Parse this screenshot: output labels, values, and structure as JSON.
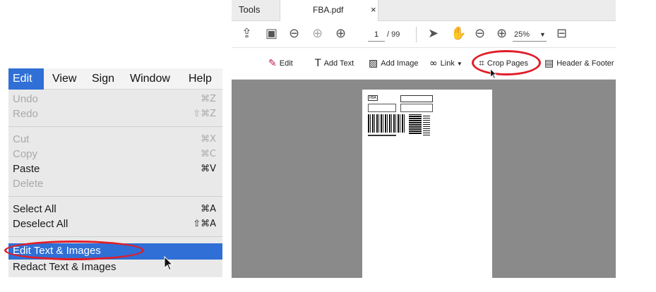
{
  "menubar": {
    "items": [
      "Edit",
      "View",
      "Sign",
      "Window",
      "Help"
    ]
  },
  "edit_menu": {
    "items": [
      {
        "label": "Undo",
        "shortcut": "⌘Z",
        "enabled": false
      },
      {
        "label": "Redo",
        "shortcut": "⇧⌘Z",
        "enabled": false
      },
      {
        "label": "Cut",
        "shortcut": "⌘X",
        "enabled": false
      },
      {
        "label": "Copy",
        "shortcut": "⌘C",
        "enabled": false
      },
      {
        "label": "Paste",
        "shortcut": "⌘V",
        "enabled": true
      },
      {
        "label": "Delete",
        "shortcut": "",
        "enabled": false
      },
      {
        "label": "Select All",
        "shortcut": "⌘A",
        "enabled": true
      },
      {
        "label": "Deselect All",
        "shortcut": "⇧⌘A",
        "enabled": true
      },
      {
        "label": "Edit Text & Images",
        "shortcut": "",
        "enabled": true,
        "highlighted": true
      },
      {
        "label": "Redact Text & Images",
        "shortcut": "",
        "enabled": true
      }
    ]
  },
  "acrobat": {
    "tabs": {
      "tools": "Tools",
      "file": "FBA.pdf",
      "close": "×"
    },
    "page_current": "1",
    "page_total": "/ 99",
    "zoom": "25%",
    "edit_toolbar": {
      "edit": "Edit",
      "add_text": "Add Text",
      "add_image": "Add Image",
      "link": "Link",
      "crop_pages": "Crop Pages",
      "header_footer": "Header & Footer"
    },
    "page_label": {
      "code": "FBA"
    }
  },
  "colors": {
    "highlight": "#2f6fd6",
    "annotation": "#e11d27",
    "canvas": "#8a8a8a",
    "edit_icon": "#c2185b"
  }
}
